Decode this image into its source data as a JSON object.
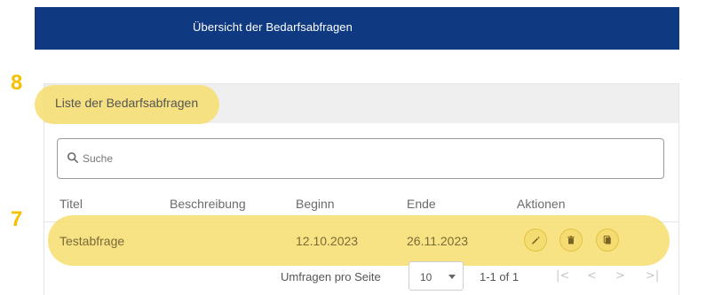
{
  "header": {
    "title": "Übersicht der Bedarfsabfragen"
  },
  "callouts": {
    "header_marker": "8",
    "row_marker": "7",
    "actions_marker": "8"
  },
  "card": {
    "title": "Liste der Bedarfsabfragen"
  },
  "search": {
    "placeholder": "Suche",
    "value": ""
  },
  "table": {
    "columns": [
      "Titel",
      "Beschreibung",
      "Beginn",
      "Ende",
      "Aktionen"
    ],
    "rows": [
      {
        "titel": "Testabfrage",
        "beschreibung": "",
        "beginn": "12.10.2023",
        "ende": "26.11.2023"
      }
    ],
    "actions": [
      {
        "icon": "pencil-icon"
      },
      {
        "icon": "trash-icon"
      },
      {
        "icon": "copy-icon"
      }
    ]
  },
  "pagination": {
    "per_page_label": "Umfragen pro Seite",
    "per_page_value": "10",
    "range_label": "1-1 of 1"
  },
  "colors": {
    "header_bg": "#0f3a82",
    "highlight": "#f7de6e",
    "callout": "#f6c000"
  }
}
